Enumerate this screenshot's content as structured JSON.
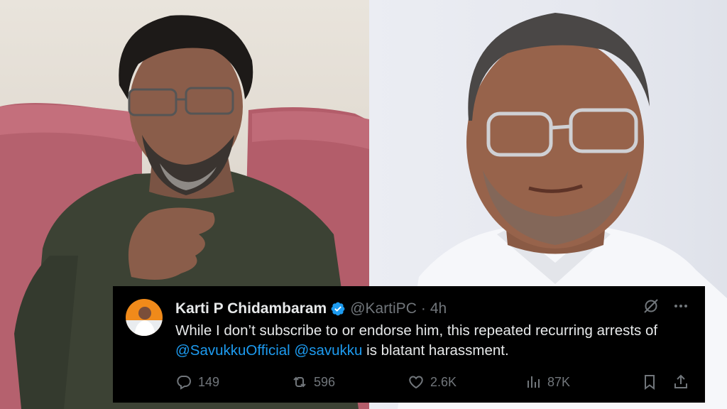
{
  "tweet": {
    "name": "Karti P Chidambaram",
    "handle": "@KartiPC",
    "separator": "·",
    "time": "4h",
    "text_plain": "While I don’t subscribe to or endorse him, this  repeated recurring arrests of",
    "mentions": [
      "@SavukkuOfficial",
      "@savukku"
    ],
    "text_tail": "is blatant harassment.",
    "replies": "149",
    "reposts": "596",
    "likes": "2.6K",
    "views": "87K"
  },
  "icons": {
    "verified": "verified-badge-icon",
    "grok": "grok-icon",
    "more": "more-icon",
    "reply": "reply-icon",
    "repost": "repost-icon",
    "like": "like-icon",
    "views": "views-icon",
    "bookmark": "bookmark-icon",
    "share": "share-icon"
  },
  "colors": {
    "card_background": "#000000",
    "text": "#e7e9ea",
    "secondary": "#71767b",
    "link": "#1d9bf0"
  }
}
